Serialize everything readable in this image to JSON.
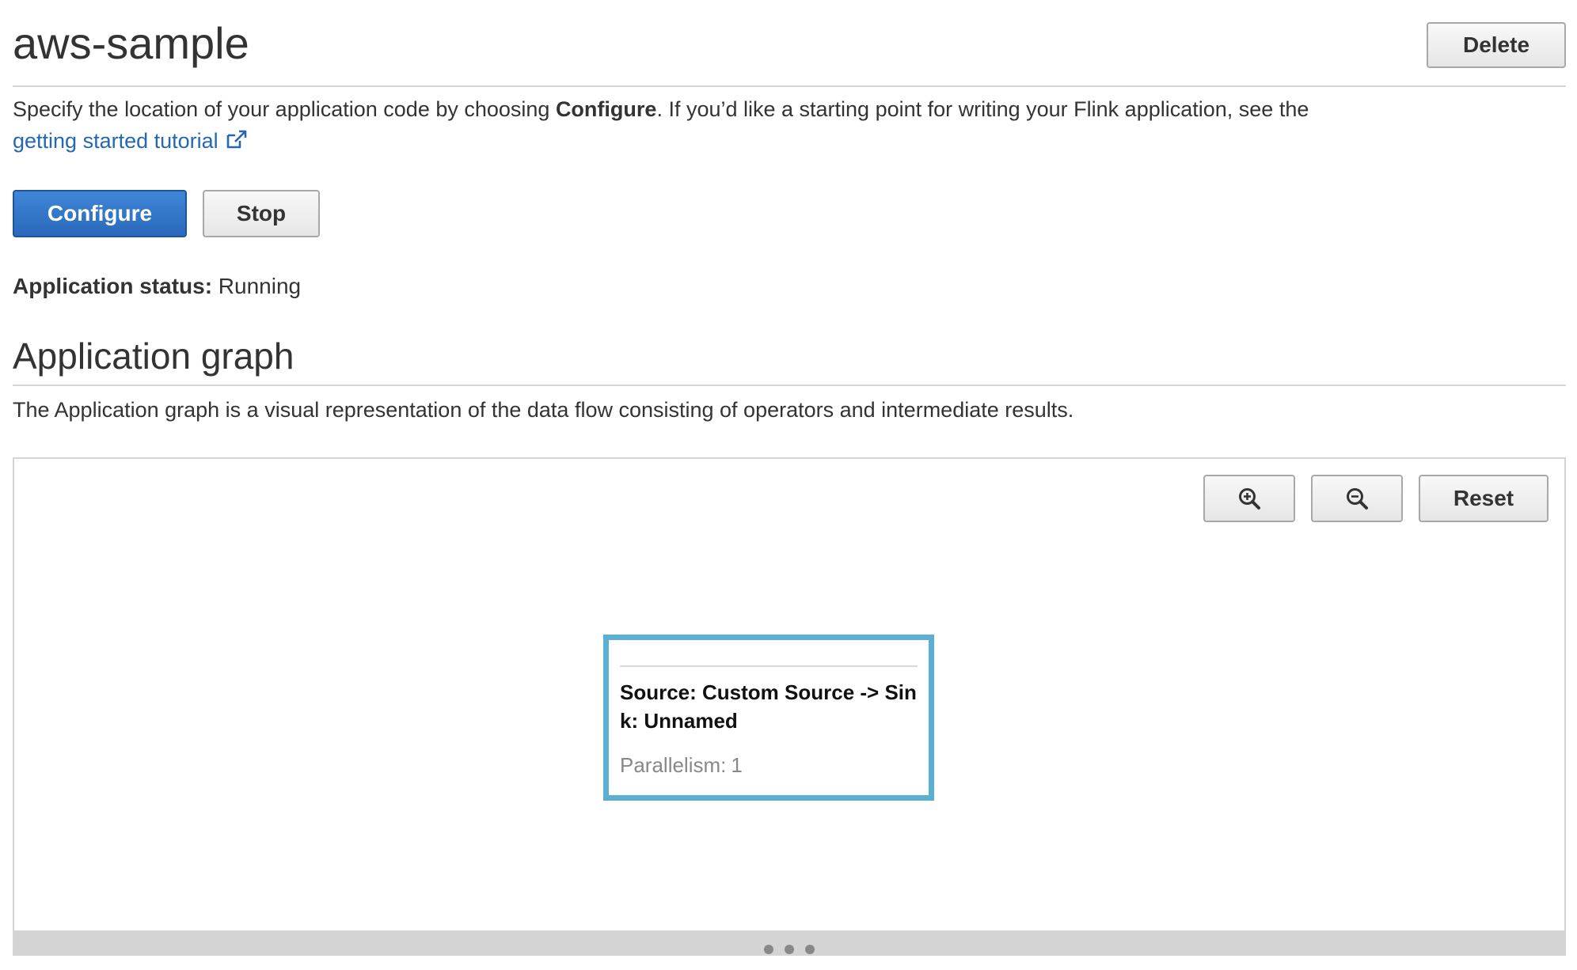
{
  "header": {
    "title": "aws-sample",
    "delete_label": "Delete"
  },
  "intro": {
    "text_before": "Specify the location of your application code by choosing ",
    "bold_word": "Configure",
    "text_after": ". If you’d like a starting point for writing your Flink application, see the",
    "link_text": "getting started tutorial",
    "link_icon": "external-link-icon"
  },
  "actions": {
    "configure_label": "Configure",
    "stop_label": "Stop"
  },
  "status": {
    "label": "Application status:",
    "value": "Running"
  },
  "graph_section": {
    "title": "Application graph",
    "description": "The Application graph is a visual representation of the data flow consisting of operators and intermediate results.",
    "controls": {
      "zoom_in_icon": "zoom-in-icon",
      "zoom_out_icon": "zoom-out-icon",
      "reset_label": "Reset"
    },
    "node": {
      "title": "Source: Custom Source -> Sink: Unnamed",
      "parallelism_label": "Parallelism:",
      "parallelism_value": "1"
    }
  },
  "colors": {
    "primary_button": "#2a69bd",
    "link": "#2468b3",
    "node_border": "#5bafd1"
  }
}
